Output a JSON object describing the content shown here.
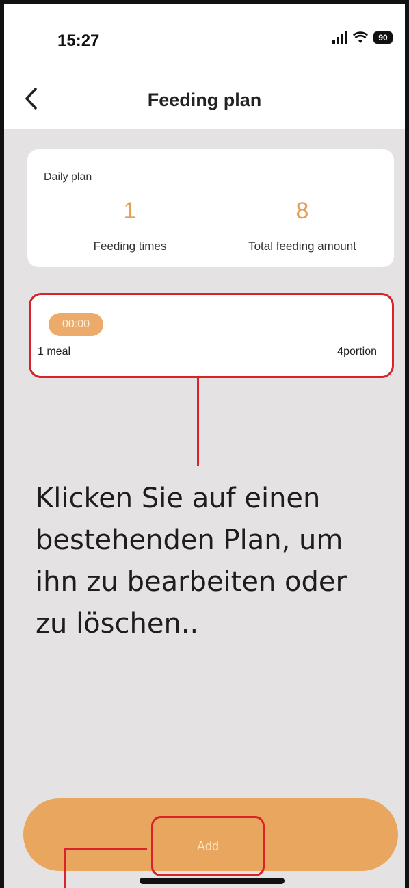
{
  "status_bar": {
    "time": "15:27",
    "battery": "90",
    "icons": [
      "signal-icon",
      "wifi-icon",
      "battery-icon"
    ]
  },
  "header": {
    "title": "Feeding plan",
    "back_icon": "chevron-left-icon"
  },
  "summary": {
    "label": "Daily plan",
    "feeding_times_value": "1",
    "feeding_times_label": "Feeding times",
    "total_amount_value": "8",
    "total_amount_label": "Total feeding amount"
  },
  "plans": [
    {
      "time": "00:00",
      "name": "1 meal",
      "portion": "4portion"
    }
  ],
  "instruction": {
    "lines": [
      "Klicken Sie auf einen",
      "bestehenden Plan, um",
      "ihn zu bearbeiten oder",
      "zu löschen.."
    ]
  },
  "footer": {
    "add_label": "Add"
  },
  "colors": {
    "accent": "#e9a65e",
    "accent_text": "#e39d56",
    "annotation_red": "#d8232a",
    "background": "#e4e2e3"
  }
}
